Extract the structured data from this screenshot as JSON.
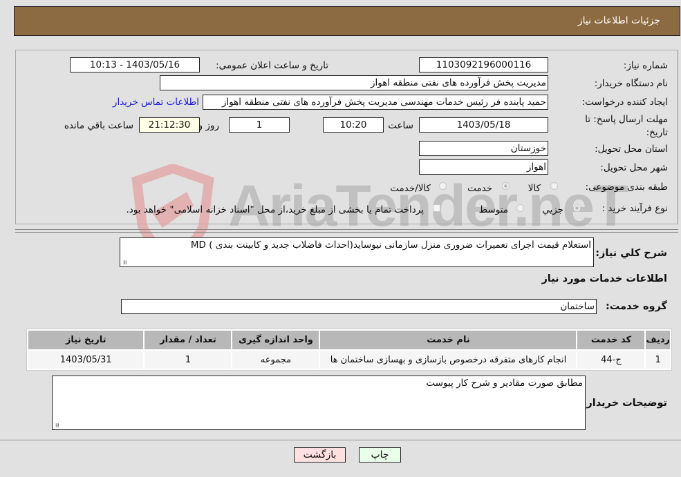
{
  "header": {
    "title": "جزئیات اطلاعات نیاز"
  },
  "fields": {
    "need_number_label": "شماره نیاز:",
    "need_number": "1103092196000116",
    "announce_label": "تاریخ و ساعت اعلان عمومی:",
    "announce_value": "1403/05/16 - 10:13",
    "buyer_org_label": "نام دستگاه خریدار:",
    "buyer_org": "مدیریت پخش فرآورده های نفتی منطقه اهواز",
    "requester_label": "ایجاد کننده درخواست:",
    "requester": "حمید پاینده فر رئیس خدمات مهندسی مدیریت پخش فرآورده های نفتی منطقه اهواز",
    "contact_link": "اطلاعات تماس خریدار",
    "deadline_label": "مهلت ارسال پاسخ: تا تاریخ:",
    "deadline_date": "1403/05/18",
    "time_label": "ساعت",
    "deadline_time": "10:20",
    "days_value": "1",
    "days_label": "روز و",
    "remaining_time": "21:12:30",
    "remaining_label": "ساعت باقي مانده",
    "province_label": "استان محل تحویل:",
    "province": "خوزستان",
    "city_label": "شهر محل تحویل:",
    "city": "اهواز",
    "category_label": "طبقه بندی موضوعی:",
    "category_options": [
      "کالا",
      "خدمت",
      "کالا/خدمت"
    ],
    "category_selected": "خدمت",
    "process_label": "نوع فرآیند خرید :",
    "process_options": [
      "جزيي",
      "متوسط"
    ],
    "process_selected": "جزيي",
    "treasury_note": "پرداخت تمام یا بخشی از مبلغ خرید،از محل \"اسناد خزانه اسلامی\" خواهد بود."
  },
  "summary": {
    "label": "شرح کلي نياز:",
    "value": "استعلام قیمت اجرای تعمیرات ضروری منزل سازمانی نیوساید(احداث فاضلاب جدید و کابینت بندی ) MD"
  },
  "services": {
    "section_title": "اطلاعات خدمات مورد نیاز",
    "group_label": "گروه خدمت:",
    "group_value": "ساختمان",
    "columns": [
      "ردیف",
      "کد خدمت",
      "نام خدمت",
      "واحد اندازه گیری",
      "تعداد / مقدار",
      "تاریخ نیاز"
    ],
    "rows": [
      [
        "1",
        "ج-44",
        "انجام کارهای متفرقه درخصوص بازسازی و بهسازی ساختمان ها",
        "مجموعه",
        "1",
        "1403/05/31"
      ]
    ]
  },
  "buyer_notes": {
    "label": "توضیحات خریدار:",
    "value": "مطابق صورت مقادیر و شرح کار پیوست"
  },
  "buttons": {
    "print": "چاپ",
    "back": "بازگشت"
  },
  "watermark": {
    "text": "AriaTender.neT"
  },
  "colors": {
    "header": "#8d6b42",
    "link": "#1a1acc",
    "print_bg": "#eaffea",
    "back_bg": "#ffe0e0"
  }
}
